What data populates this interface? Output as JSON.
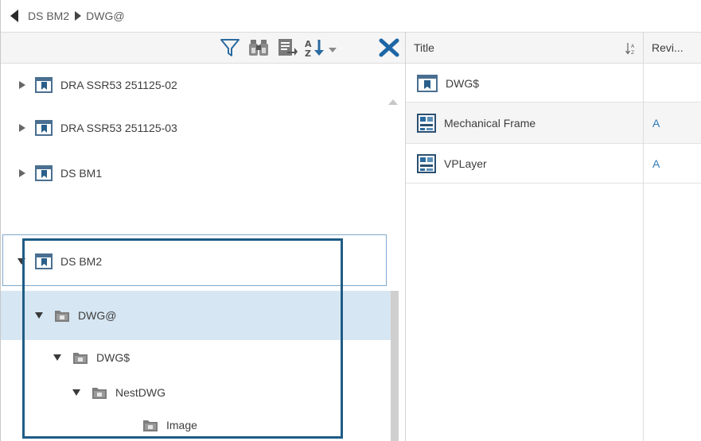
{
  "breadcrumb": {
    "items": [
      "DS BM2",
      "DWG@"
    ]
  },
  "toolbar": {
    "icons": [
      "filter-icon",
      "binoculars-icon",
      "export-icon",
      "sort-az-icon",
      "dropdown-arrow-icon",
      "clear-icon"
    ]
  },
  "tree": {
    "rows": [
      {
        "label": "DRA SSR53 251125-02",
        "expanded": false,
        "icon": "bookmark-folder-icon"
      },
      {
        "label": "DRA SSR53 251125-03",
        "expanded": false,
        "icon": "bookmark-folder-icon"
      },
      {
        "label": "DS BM1",
        "expanded": false,
        "icon": "bookmark-folder-icon"
      },
      {
        "label": "DS BM2",
        "expanded": true,
        "icon": "bookmark-folder-icon"
      },
      {
        "label": "DWG@",
        "expanded": true,
        "selected": true,
        "icon": "folder-icon"
      },
      {
        "label": "DWG$",
        "expanded": true,
        "icon": "folder-icon"
      },
      {
        "label": "NestDWG",
        "expanded": true,
        "icon": "folder-icon"
      },
      {
        "label": "Image",
        "icon": "folder-icon"
      }
    ]
  },
  "grid": {
    "columns": {
      "title": "Title",
      "revision": "Revi..."
    },
    "rows": [
      {
        "title": "DWG$",
        "revision": "",
        "icon": "bookmark-folder-icon"
      },
      {
        "title": "Mechanical Frame",
        "revision": "A",
        "icon": "drawing-icon"
      },
      {
        "title": "VPLayer",
        "revision": "A",
        "icon": "drawing-icon"
      }
    ]
  },
  "colors": {
    "selection": "#d6e6f2",
    "highlight_box": "#1f5c86",
    "link": "#2f7ab8",
    "clear_icon": "#1d66a6"
  }
}
